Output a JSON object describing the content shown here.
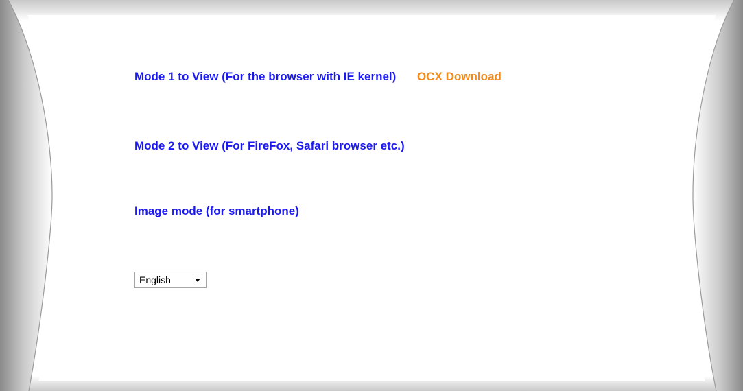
{
  "links": {
    "mode1_label": "Mode 1 to View (For the browser with IE kernel)",
    "ocx_label": "OCX Download",
    "mode2_label": "Mode 2 to View (For FireFox, Safari browser etc.)",
    "image_mode_label": "Image mode (for smartphone)"
  },
  "language_select": {
    "selected": "English"
  },
  "colors": {
    "link_blue": "#1a1af0",
    "link_orange": "#f28a1c",
    "frame_gray": "#8c8c8c"
  }
}
